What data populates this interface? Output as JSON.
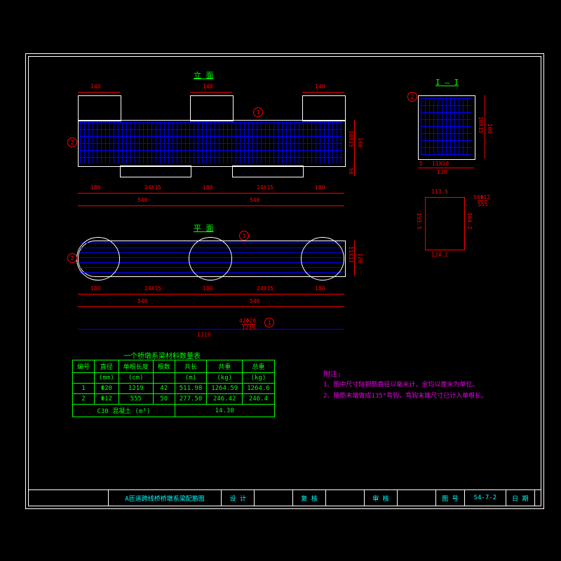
{
  "views": {
    "elevation": "立 面",
    "plan": "平 面",
    "section": "I — I"
  },
  "dims": {
    "d140": "140",
    "d180": "180",
    "d540": "540",
    "d24x15": "24X15",
    "d160": "160",
    "d10x15": "10X15",
    "d50": "50",
    "d120": "120",
    "d11x10": "11X10",
    "d11x11": "11X11",
    "d5": "5",
    "d113_5": "113.5",
    "d124_2": "124.2",
    "d153_5": "153.5",
    "d164_2": "164.2",
    "d50x12": "50Φ12",
    "d555": "555",
    "bar_len": "1219",
    "bar_spec": "42Φ20",
    "bar_ref": "1219",
    "b1": "1",
    "b2": "2"
  },
  "table": {
    "title": "一个桥墩系梁材料数量表",
    "headers": [
      "编号",
      "直径",
      "单根长度",
      "根数",
      "共长",
      "共重",
      "总重"
    ],
    "units": [
      "",
      "(mm)",
      "(cm)",
      "",
      "(m)",
      "(kg)",
      "(kg)"
    ],
    "rows": [
      [
        "1",
        "Φ20",
        "1219",
        "42",
        "511.98",
        "1264.59",
        "1264.6"
      ],
      [
        "2",
        "Φ12",
        "555",
        "50",
        "277.50",
        "246.42",
        "246.4"
      ]
    ],
    "concrete_label": "C30 混凝土 (m³)",
    "concrete_val": "14.38"
  },
  "notes": {
    "title": "附注:",
    "n1": "1、图中尺寸除钢筋直径以毫米计，余均以厘米为单位。",
    "n2": "2、箍筋末端做成135°弯钩，弯钩末端尺寸已计入单根长。"
  },
  "titleblock": {
    "drawing": "A匝道跨线桥桥墩系梁配筋图",
    "design": "设 计",
    "recheck": "复 核",
    "审核": "审 核",
    "图号l": "图 号",
    "图号v": "S4-7-2",
    "日期": "日 期"
  }
}
